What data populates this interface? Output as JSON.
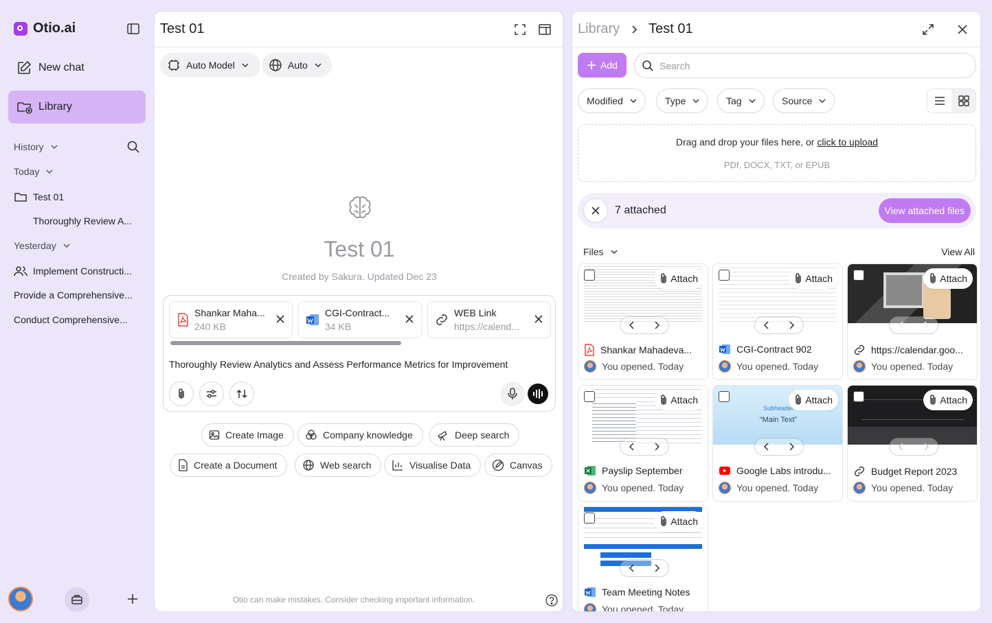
{
  "sidebar": {
    "app_name": "Otio.ai",
    "new_chat": "New chat",
    "library": "Library",
    "history": "History",
    "today": "Today",
    "today_items": [
      "Test 01",
      "Thoroughly Review A..."
    ],
    "yesterday": "Yesterday",
    "yesterday_items": [
      "Implement Constructi...",
      "Provide a Comprehensive...",
      "Conduct Comprehensive..."
    ]
  },
  "chat": {
    "title": "Test 01",
    "model_label": "Auto Model",
    "web_label": "Auto",
    "heading": "Test 01",
    "created": "Created by Sakura. Updated Dec 23",
    "chips": [
      {
        "name": "Shankar Maha...",
        "size": "240 KB",
        "type": "pdf"
      },
      {
        "name": "CGI-Contract...",
        "size": "34 KB",
        "type": "word"
      },
      {
        "name": "WEB Link",
        "size": "https://calend...",
        "type": "link"
      }
    ],
    "prompt": "Thoroughly Review Analytics and Assess Performance Metrics for Improvement",
    "actions_row1": [
      "Create Image",
      "Company knowledge",
      "Deep search"
    ],
    "actions_row2": [
      "Create a Document",
      "Web search",
      "Visualise Data",
      "Canvas"
    ],
    "disclaimer": "Otio can make mistakes. Consider checking important information."
  },
  "library": {
    "breadcrumb_root": "Library",
    "breadcrumb_current": "Test 01",
    "add": "Add",
    "search_placeholder": "Search",
    "filters": [
      "Modified",
      "Type",
      "Tag",
      "Source"
    ],
    "drop_text": "Drag and drop your files here, or ",
    "drop_link": "click to upload",
    "drop_formats": "PDf, DOCX, TXT, or EPUB",
    "attached": "7 attached",
    "view_attached": "View attached files",
    "files_label": "Files",
    "view_all": "View All",
    "attach_label": "Attach",
    "cards": [
      {
        "name": "Shankar Mahadeva...",
        "meta": "You opened. Today",
        "type": "pdf"
      },
      {
        "name": "CGI-Contract 902",
        "meta": "You opened. Today",
        "type": "word"
      },
      {
        "name": "https://calendar.goo...",
        "meta": "You opened. Today",
        "type": "link"
      },
      {
        "name": "Payslip September",
        "meta": "You opened. Today",
        "type": "excel"
      },
      {
        "name": "Google Labs introdu...",
        "meta": "You opened. Today",
        "type": "youtube"
      },
      {
        "name": "Budget Report 2023",
        "meta": "You opened. Today",
        "type": "link"
      },
      {
        "name": "Team Meeting Notes",
        "meta": "You opened. Today",
        "type": "word"
      }
    ],
    "thumb_texts": {
      "subheader": "Subheader",
      "main_text": "“Main Text”"
    }
  },
  "colors": {
    "accent": "#c17bf2",
    "library_active": "#d6b4f6",
    "background": "#ece6fb"
  }
}
